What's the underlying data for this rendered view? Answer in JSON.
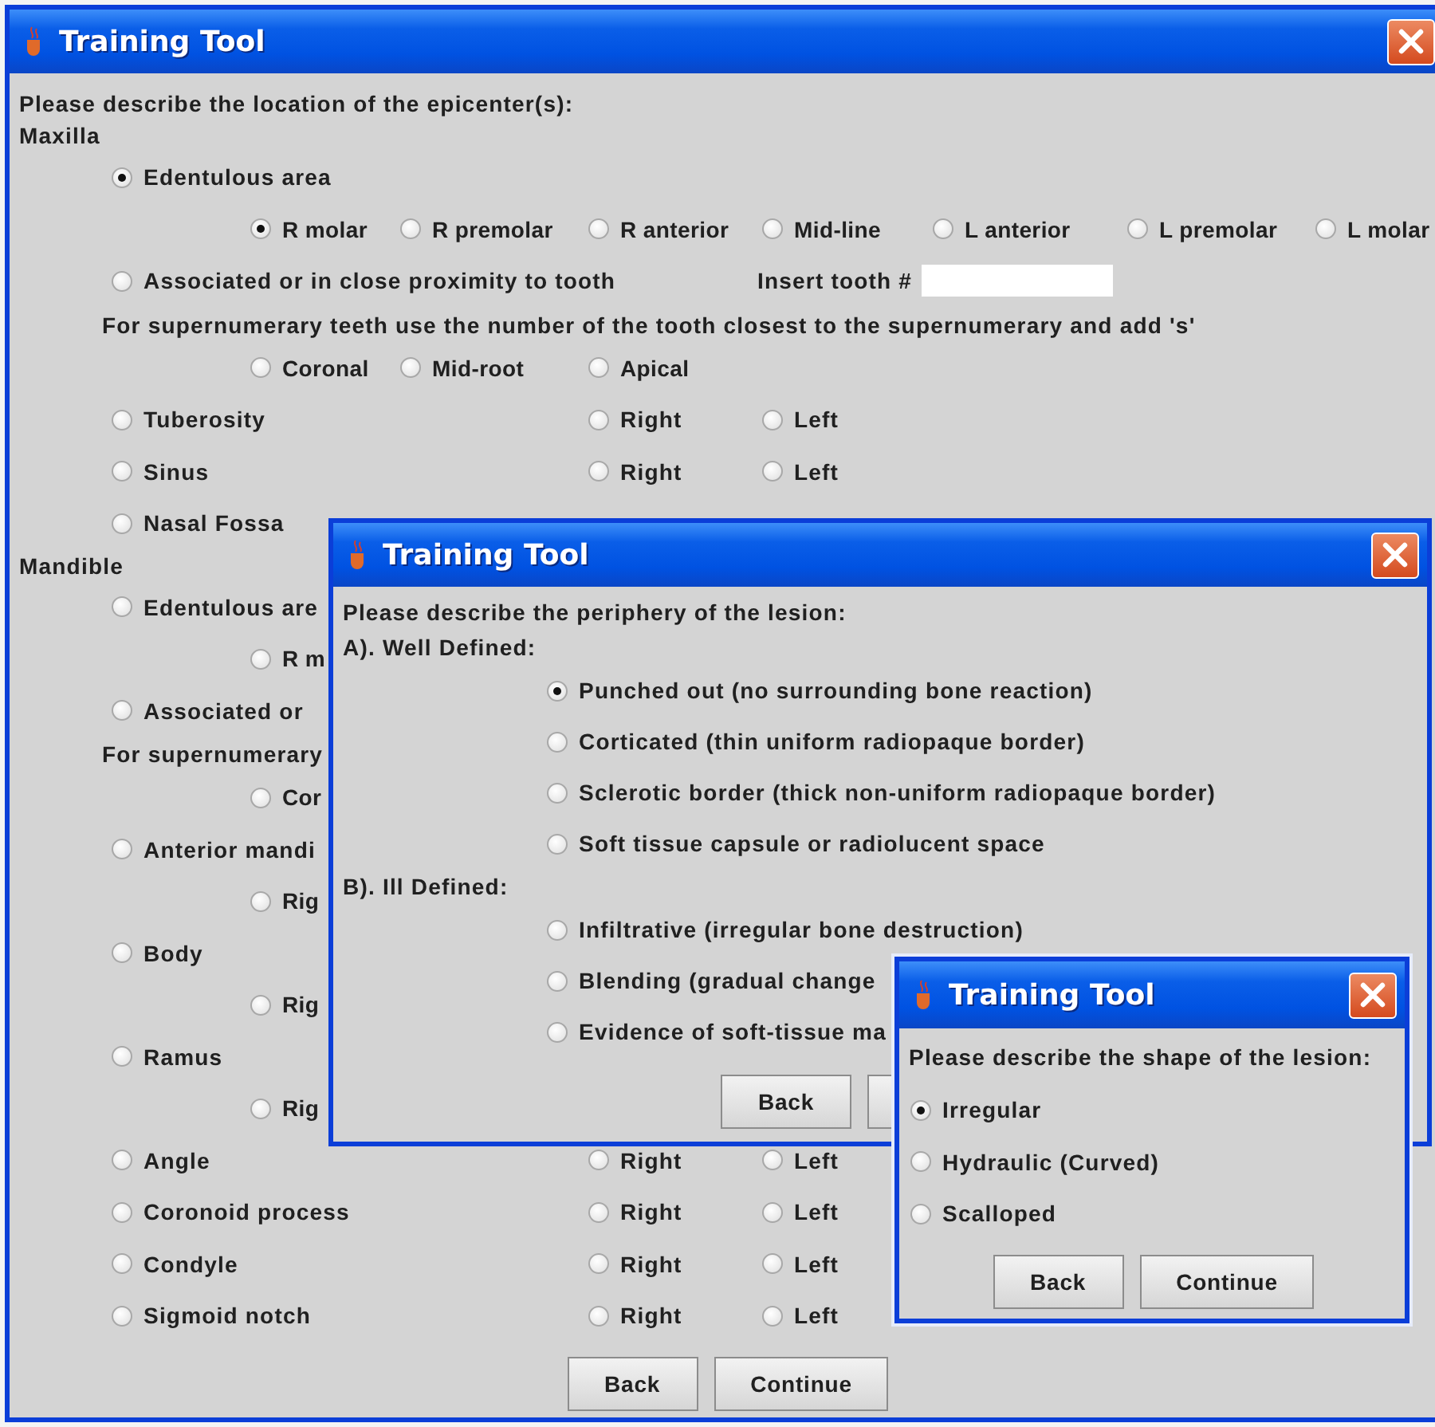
{
  "windows": [
    {
      "kind": "main",
      "title": "Training Tool",
      "rows": [
        {
          "kind": "heading",
          "text": "Please describe the location of the epicenter(s):"
        },
        {
          "kind": "heading",
          "text": "Maxilla"
        },
        {
          "kind": "option",
          "label": "Edentulous area",
          "selected": true
        },
        {
          "kind": "choices",
          "options": [
            {
              "label": "R molar",
              "selected": true
            },
            {
              "label": "R premolar",
              "selected": false
            },
            {
              "label": "R anterior",
              "selected": false
            },
            {
              "label": "Mid-line",
              "selected": false
            },
            {
              "label": "L anterior",
              "selected": false
            },
            {
              "label": "L premolar",
              "selected": false
            },
            {
              "label": "L molar",
              "selected": false
            }
          ]
        },
        {
          "kind": "tooth",
          "label": "Associated or in close proximity to tooth",
          "selected": false,
          "field_label": "Insert tooth #"
        },
        {
          "kind": "note",
          "text": "For supernumerary teeth use the number of the tooth closest to the supernumerary and add 's'"
        },
        {
          "kind": "choices",
          "options": [
            {
              "label": "Coronal",
              "selected": false
            },
            {
              "label": "Mid-root",
              "selected": false
            },
            {
              "label": "Apical",
              "selected": false
            }
          ]
        },
        {
          "kind": "option",
          "label": "Tuberosity",
          "selected": false,
          "sides": [
            {
              "label": "Right",
              "selected": false
            },
            {
              "label": "Left",
              "selected": false
            }
          ]
        },
        {
          "kind": "option",
          "label": "Sinus",
          "selected": false,
          "sides": [
            {
              "label": "Right",
              "selected": false
            },
            {
              "label": "Left",
              "selected": false
            }
          ]
        },
        {
          "kind": "option",
          "label": "Nasal Fossa",
          "selected": false
        },
        {
          "kind": "heading",
          "text": "Mandible"
        },
        {
          "kind": "option",
          "label": "Edentulous are",
          "selected": false
        },
        {
          "kind": "choices",
          "options": [
            {
              "label": "R m",
              "selected": false
            }
          ]
        },
        {
          "kind": "option",
          "label": "Associated or",
          "selected": false
        },
        {
          "kind": "note",
          "text": "For supernumerary"
        },
        {
          "kind": "choices",
          "options": [
            {
              "label": "Cor",
              "selected": false
            }
          ]
        },
        {
          "kind": "option",
          "label": "Anterior mandi",
          "selected": false
        },
        {
          "kind": "choices",
          "options": [
            {
              "label": "Rig",
              "selected": false
            }
          ]
        },
        {
          "kind": "option",
          "label": "Body",
          "selected": false
        },
        {
          "kind": "choices",
          "options": [
            {
              "label": "Rig",
              "selected": false
            }
          ]
        },
        {
          "kind": "option",
          "label": "Ramus",
          "selected": false
        },
        {
          "kind": "choices",
          "options": [
            {
              "label": "Rig",
              "selected": false
            }
          ]
        },
        {
          "kind": "option",
          "label": "Angle",
          "selected": false,
          "sides": [
            {
              "label": "Right",
              "selected": false
            },
            {
              "label": "Left",
              "selected": false
            }
          ]
        },
        {
          "kind": "option",
          "label": "Coronoid process",
          "selected": false,
          "sides": [
            {
              "label": "Right",
              "selected": false
            },
            {
              "label": "Left",
              "selected": false
            }
          ]
        },
        {
          "kind": "option",
          "label": "Condyle",
          "selected": false,
          "sides": [
            {
              "label": "Right",
              "selected": false
            },
            {
              "label": "Left",
              "selected": false
            }
          ]
        },
        {
          "kind": "option",
          "label": "Sigmoid notch",
          "selected": false,
          "sides": [
            {
              "label": "Right",
              "selected": false
            },
            {
              "label": "Left",
              "selected": false
            }
          ]
        }
      ],
      "buttons": [
        {
          "kind": "text",
          "label": "Back"
        },
        {
          "kind": "text",
          "label": "Continue"
        }
      ]
    },
    {
      "kind": "periphery",
      "title": "Training Tool",
      "rows": [
        {
          "kind": "heading",
          "text": "Please describe the periphery of the lesion:"
        },
        {
          "kind": "heading",
          "text": "A). Well Defined:"
        },
        {
          "kind": "option",
          "label": "Punched out (no surrounding bone reaction)",
          "selected": true
        },
        {
          "kind": "option",
          "label": "Corticated (thin uniform radiopaque border)",
          "selected": false
        },
        {
          "kind": "option",
          "label": "Sclerotic border (thick non-uniform radiopaque border)",
          "selected": false
        },
        {
          "kind": "option",
          "label": "Soft tissue capsule or radiolucent space",
          "selected": false
        },
        {
          "kind": "heading",
          "text": "B). Ill Defined:"
        },
        {
          "kind": "option",
          "label": "Infiltrative (irregular bone destruction)",
          "selected": false
        },
        {
          "kind": "option",
          "label": "Blending (gradual change",
          "selected": false
        },
        {
          "kind": "option",
          "label": "Evidence of soft-tissue ma",
          "selected": false
        }
      ],
      "buttons": [
        {
          "kind": "text",
          "label": "Back"
        },
        {
          "kind": "blank"
        }
      ]
    },
    {
      "kind": "shape",
      "title": "Training Tool",
      "rows": [
        {
          "kind": "heading",
          "text": "Please describe the shape of the lesion:"
        },
        {
          "kind": "option",
          "label": "Irregular",
          "selected": true
        },
        {
          "kind": "option",
          "label": "Hydraulic (Curved)",
          "selected": false
        },
        {
          "kind": "option",
          "label": "Scalloped",
          "selected": false
        }
      ],
      "buttons": [
        {
          "kind": "text",
          "label": "Back"
        },
        {
          "kind": "text",
          "label": "Continue"
        }
      ]
    }
  ]
}
